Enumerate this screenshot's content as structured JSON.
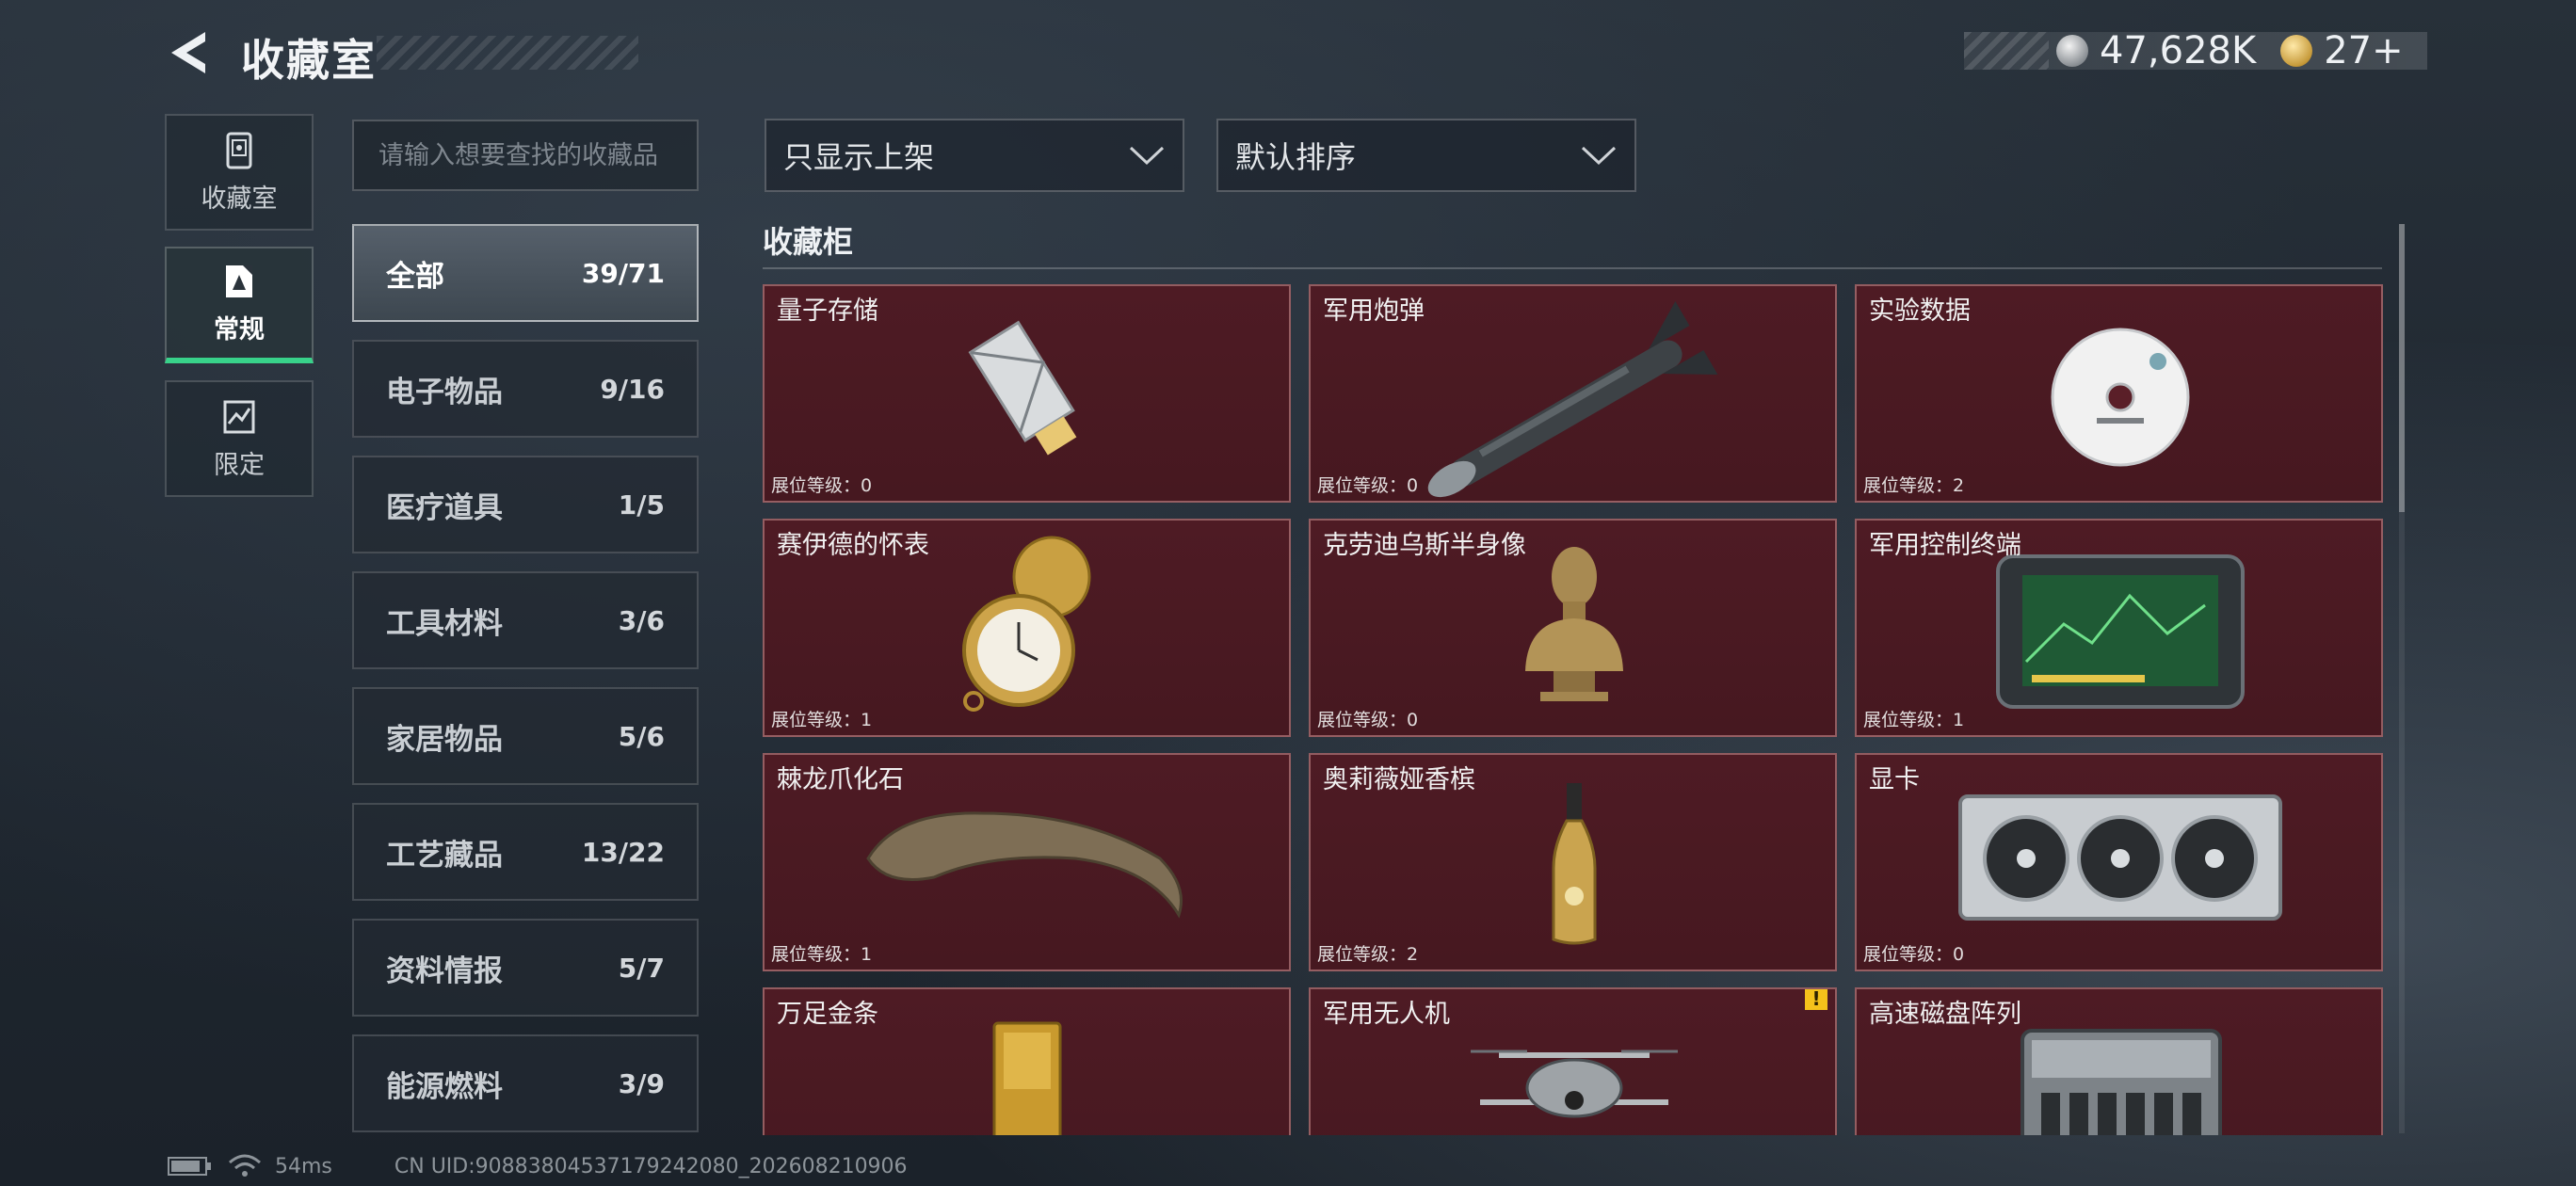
{
  "header": {
    "title": "收藏室",
    "currencies": [
      {
        "icon": "silver-coin-icon",
        "value": "47,628K"
      },
      {
        "icon": "gold-coin-icon",
        "value": "27+"
      }
    ]
  },
  "sidebar": {
    "items": [
      {
        "label": "收藏室",
        "icon": "collection-room-icon",
        "active": false
      },
      {
        "label": "常规",
        "icon": "regular-icon",
        "active": true
      },
      {
        "label": "限定",
        "icon": "limited-icon",
        "active": false
      }
    ]
  },
  "search": {
    "placeholder": "请输入想要查找的收藏品"
  },
  "categories": [
    {
      "name": "全部",
      "count": "39/71",
      "active": true
    },
    {
      "name": "电子物品",
      "count": "9/16"
    },
    {
      "name": "医疗道具",
      "count": "1/5"
    },
    {
      "name": "工具材料",
      "count": "3/6"
    },
    {
      "name": "家居物品",
      "count": "5/6"
    },
    {
      "name": "工艺藏品",
      "count": "13/22"
    },
    {
      "name": "资料情报",
      "count": "5/7"
    },
    {
      "name": "能源燃料",
      "count": "3/9"
    }
  ],
  "filters": {
    "listing": "只显示上架",
    "sort": "默认排序"
  },
  "section": {
    "title": "收藏柜"
  },
  "items": [
    {
      "name": "量子存储",
      "level": "展位等级：0",
      "icon": "usb-drive-icon"
    },
    {
      "name": "军用炮弹",
      "level": "展位等级：0",
      "icon": "missile-icon"
    },
    {
      "name": "实验数据",
      "level": "展位等级：2",
      "icon": "disc-icon"
    },
    {
      "name": "赛伊德的怀表",
      "level": "展位等级：1",
      "icon": "pocket-watch-icon"
    },
    {
      "name": "克劳迪乌斯半身像",
      "level": "展位等级：0",
      "icon": "bust-icon"
    },
    {
      "name": "军用控制终端",
      "level": "展位等级：1",
      "icon": "control-terminal-icon"
    },
    {
      "name": "棘龙爪化石",
      "level": "展位等级：1",
      "icon": "claw-fossil-icon"
    },
    {
      "name": "奥莉薇娅香槟",
      "level": "展位等级：2",
      "icon": "champagne-icon"
    },
    {
      "name": "显卡",
      "level": "展位等级：0",
      "icon": "graphics-card-icon"
    },
    {
      "name": "万足金条",
      "level": "",
      "icon": "gold-bar-icon"
    },
    {
      "name": "军用无人机",
      "level": "",
      "icon": "drone-icon",
      "warning": "!"
    },
    {
      "name": "高速磁盘阵列",
      "level": "",
      "icon": "disk-array-icon"
    }
  ],
  "footer": {
    "ping": "54ms",
    "uid": "CN UID:908838045371792420​80_202608210906"
  },
  "colors": {
    "accent": "#38d28a",
    "card_bg": "#4e1b24",
    "warning": "#f4c21b"
  }
}
